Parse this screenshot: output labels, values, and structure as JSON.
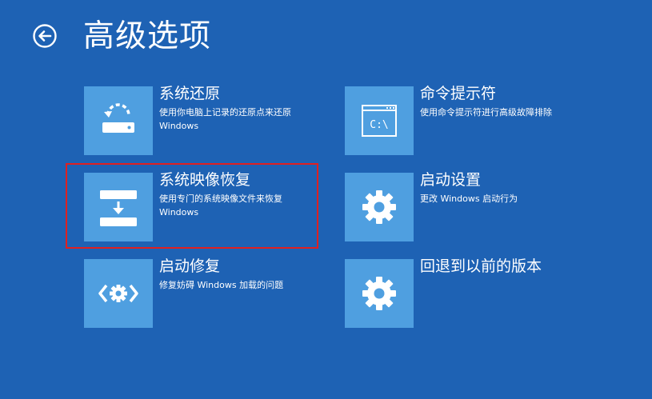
{
  "header": {
    "title": "高级选项",
    "back_icon": "back-arrow-icon"
  },
  "options": [
    {
      "title": "系统还原",
      "desc_line1": "使用你电脑上记录的还原点来还原",
      "desc_line2": "Windows",
      "icon": "system-restore-icon"
    },
    {
      "title": "命令提示符",
      "desc_line1": "使用命令提示符进行高级故障排除",
      "desc_line2": "",
      "icon": "command-prompt-icon",
      "icon_text": "C:\\"
    },
    {
      "title": "系统映像恢复",
      "desc_line1": "使用专门的系统映像文件来恢复",
      "desc_line2": "Windows",
      "icon": "system-image-recovery-icon"
    },
    {
      "title": "启动设置",
      "desc_line1": "更改 Windows 启动行为",
      "desc_line2": "",
      "icon": "gear-icon"
    },
    {
      "title": "启动修复",
      "desc_line1": "修复妨碍 Windows 加载的问题",
      "desc_line2": "",
      "icon": "startup-repair-icon"
    },
    {
      "title": "回退到以前的版本",
      "desc_line1": "",
      "desc_line2": "",
      "icon": "gear-icon"
    }
  ],
  "colors": {
    "background": "#1e62b4",
    "tile": "#4f9fe0",
    "highlight": "#e02020"
  }
}
